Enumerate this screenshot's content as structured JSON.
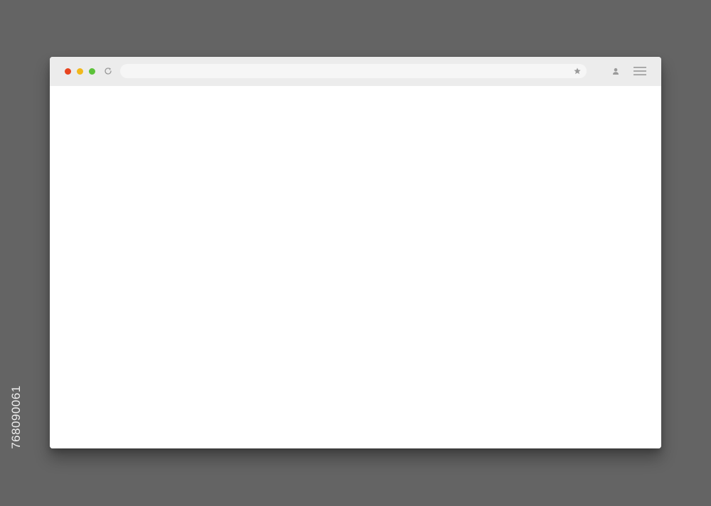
{
  "colors": {
    "background": "#646464",
    "window": "#ffffff",
    "toolbar": "#ececec",
    "address_bar": "#f6f6f6",
    "icon": "#9a9a9a",
    "traffic_close": "#e8441f",
    "traffic_minimize": "#f1b81c",
    "traffic_maximize": "#5cc23a"
  },
  "toolbar": {
    "traffic_lights": [
      "close",
      "minimize",
      "maximize"
    ],
    "address_bar": {
      "value": ""
    },
    "icons": {
      "reload": "reload-icon",
      "bookmark": "star-icon",
      "account": "user-icon",
      "menu": "hamburger-menu-icon"
    }
  },
  "page": {
    "content": ""
  },
  "watermark": {
    "id_text": "768090061"
  }
}
